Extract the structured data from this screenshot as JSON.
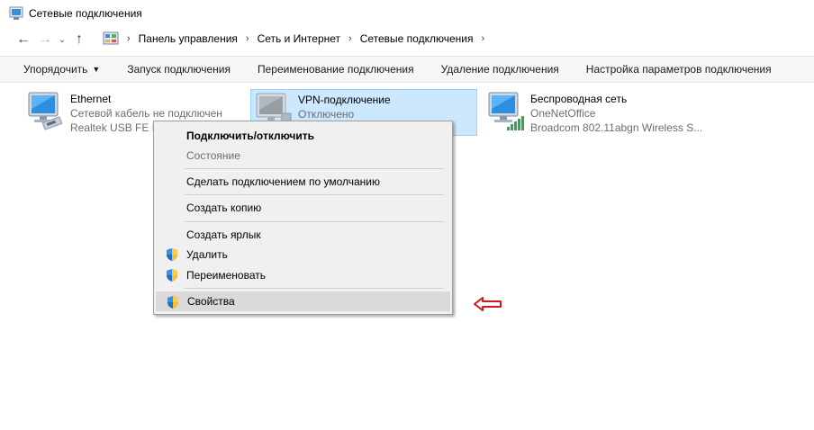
{
  "window": {
    "title": "Сетевые подключения"
  },
  "address": {
    "breadcrumbs": [
      "Панель управления",
      "Сеть и Интернет",
      "Сетевые подключения"
    ]
  },
  "toolbar": {
    "organize": "Упорядочить",
    "items": [
      "Запуск подключения",
      "Переименование подключения",
      "Удаление подключения",
      "Настройка параметров подключения"
    ]
  },
  "connections": [
    {
      "name": "Ethernet",
      "status": "Сетевой кабель не подключен",
      "device": "Realtek USB FE Fa",
      "icon": "ethernet-adapter-icon"
    },
    {
      "name": "VPN-подключение",
      "status": "Отключено",
      "device": "",
      "icon": "vpn-adapter-icon"
    },
    {
      "name": "Беспроводная сеть",
      "status": "OneNetOffice",
      "device": "Broadcom 802.11abgn Wireless S...",
      "icon": "wireless-adapter-icon"
    }
  ],
  "context_menu": {
    "items": [
      {
        "label": "Подключить/отключить",
        "bold": true
      },
      {
        "label": "Состояние",
        "disabled": true
      },
      {
        "label": "Сделать подключением по умолчанию"
      },
      {
        "label": "Создать копию"
      },
      {
        "label": "Создать ярлык"
      },
      {
        "label": "Удалить",
        "icon": "uac-shield-icon"
      },
      {
        "label": "Переименовать",
        "icon": "uac-shield-icon"
      },
      {
        "label": "Свойства",
        "icon": "uac-shield-icon",
        "highlighted": true
      }
    ]
  },
  "colors": {
    "selection_bg": "#cce8ff",
    "selection_border": "#99d1ff",
    "annotation_arrow": "#d9141e"
  }
}
